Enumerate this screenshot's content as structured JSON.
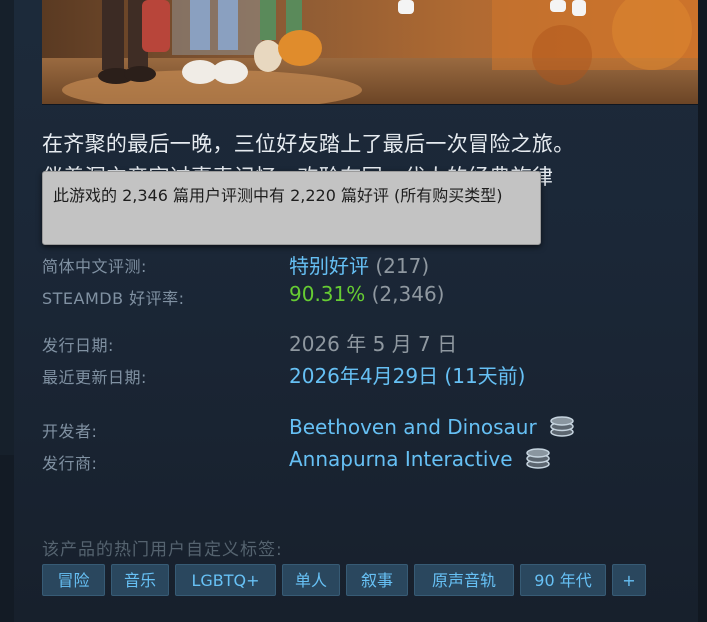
{
  "description": "在齐聚的最后一晚，三位好友踏上了最后一次冒险之旅。\n伴着洞穴帝牢过事表记忆，欢聆在同一代人的经典旋律",
  "tooltip": {
    "text": "此游戏的 2,346 篇用户评测中有 2,220 篇好评 (所有购买类型)"
  },
  "reviews": {
    "chinese_label": "简体中文评测:",
    "chinese_summary": "特别好评",
    "chinese_count": "(217)",
    "steamdb_label": "STEAMDB 好评率:",
    "steamdb_rating": "90.31%",
    "steamdb_count": "(2,346)"
  },
  "dates": {
    "release_label": "发行日期:",
    "release_value": "2026 年 5 月 7 日",
    "update_label": "最近更新日期:",
    "update_value": "2026年4月29日 (11天前)"
  },
  "companies": {
    "developer_label": "开发者:",
    "developer_value": "Beethoven and Dinosaur",
    "publisher_label": "发行商:",
    "publisher_value": "Annapurna Interactive"
  },
  "tags": {
    "title": "该产品的热门用户自定义标签:",
    "items": [
      "冒险",
      "音乐",
      "LGBTQ+",
      "单人",
      "叙事",
      "原声音轨",
      "90 年代",
      "+"
    ]
  },
  "colors": {
    "background": "#1b2838",
    "link": "#66c0f4",
    "positive": "#66cc33",
    "tag_bg": "#2a475e",
    "tooltip_bg": "#c3c3c3"
  }
}
